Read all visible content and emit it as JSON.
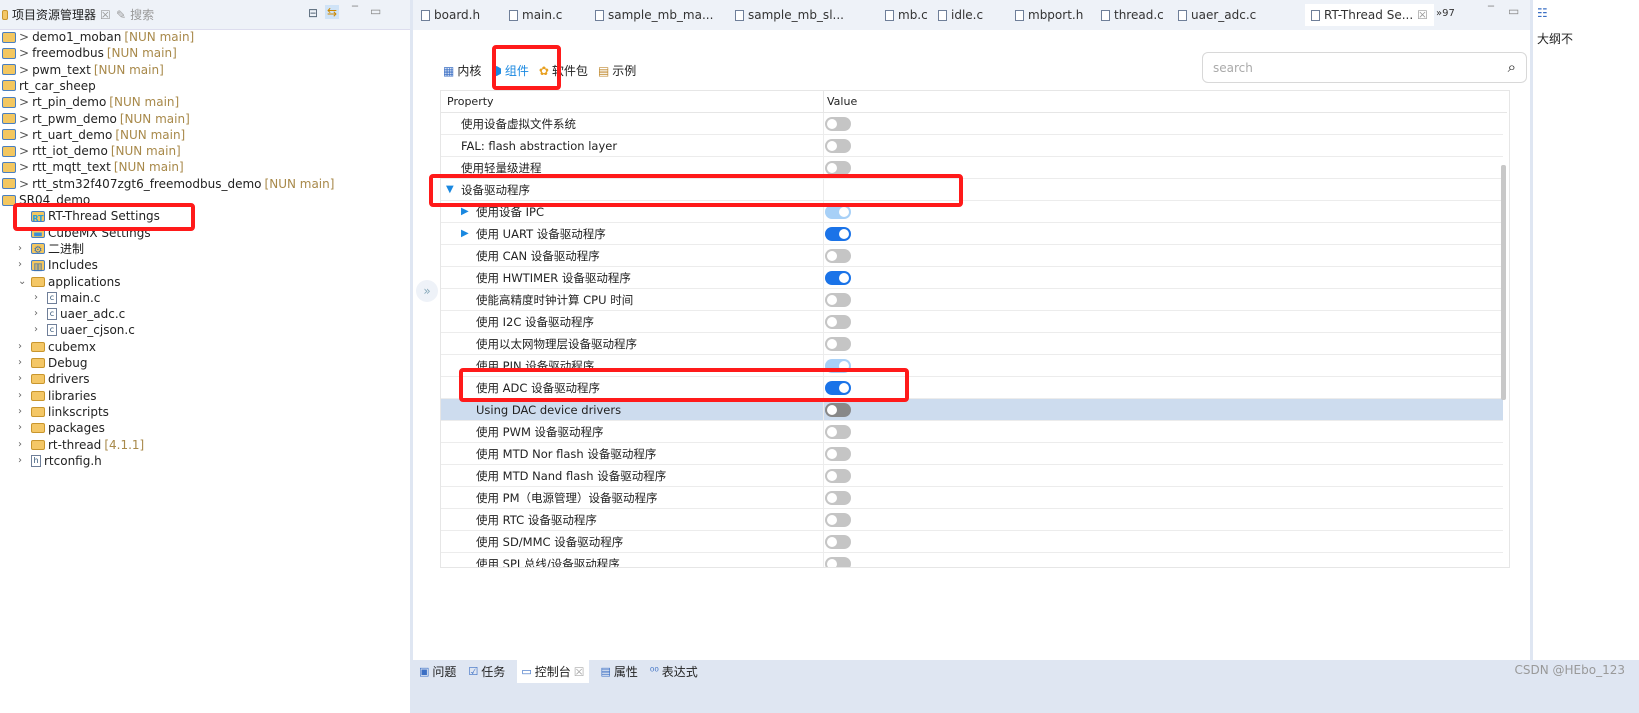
{
  "left_panel": {
    "tab_explorer": "项目资源管理器",
    "tab_search": "搜索",
    "tree": [
      {
        "label": "demo1_moban",
        "tag": "[NUN main]",
        "indent": 0,
        "icon": "project-warning-icon",
        "arrow": ">"
      },
      {
        "label": "freemodbus",
        "tag": "[NUN main]",
        "indent": 0,
        "icon": "project-warning-icon",
        "arrow": ">"
      },
      {
        "label": "pwm_text",
        "tag": "[NUN main]",
        "indent": 0,
        "icon": "project-icon",
        "arrow": ">"
      },
      {
        "label": "rt_car_sheep",
        "tag": "",
        "indent": 0,
        "icon": "project-icon",
        "arrow": ""
      },
      {
        "label": "rt_pin_demo",
        "tag": "[NUN main]",
        "indent": 0,
        "icon": "project-warning-icon",
        "arrow": ">"
      },
      {
        "label": "rt_pwm_demo",
        "tag": "[NUN main]",
        "indent": 0,
        "icon": "project-warning-icon",
        "arrow": ">"
      },
      {
        "label": "rt_uart_demo",
        "tag": "[NUN main]",
        "indent": 0,
        "icon": "project-icon",
        "arrow": ">"
      },
      {
        "label": "rtt_iot_demo",
        "tag": "[NUN main]",
        "indent": 0,
        "icon": "project-icon",
        "arrow": ">"
      },
      {
        "label": "rtt_mqtt_text",
        "tag": "[NUN main]",
        "indent": 0,
        "icon": "project-icon",
        "arrow": ">"
      },
      {
        "label": "rtt_stm32f407zgt6_freemodbus_demo",
        "tag": "[NUN main]",
        "indent": 0,
        "icon": "project-icon",
        "arrow": ">"
      },
      {
        "label": "SR04_demo",
        "tag": "",
        "indent": 0,
        "icon": "project-warning-icon",
        "arrow": ""
      },
      {
        "label": "RT-Thread Settings",
        "tag": "",
        "indent": 1,
        "icon": "rt-thread-icon",
        "arrow": ""
      },
      {
        "label": "CubeMX Settings",
        "tag": "",
        "indent": 1,
        "icon": "cubemx-icon",
        "arrow": ""
      },
      {
        "label": "二进制",
        "tag": "",
        "indent": 1,
        "icon": "binary-icon",
        "arrow": "›"
      },
      {
        "label": "Includes",
        "tag": "",
        "indent": 1,
        "icon": "includes-icon",
        "arrow": "›"
      },
      {
        "label": "applications",
        "tag": "",
        "indent": 1,
        "icon": "folder-icon",
        "arrow": "⌄"
      },
      {
        "label": "main.c",
        "tag": "",
        "indent": 2,
        "icon": "c-file-icon",
        "arrow": "›"
      },
      {
        "label": "uaer_adc.c",
        "tag": "",
        "indent": 2,
        "icon": "c-file-icon",
        "arrow": "›"
      },
      {
        "label": "uaer_cjson.c",
        "tag": "",
        "indent": 2,
        "icon": "c-file-icon",
        "arrow": "›"
      },
      {
        "label": "cubemx",
        "tag": "",
        "indent": 1,
        "icon": "folder-icon",
        "arrow": "›"
      },
      {
        "label": "Debug",
        "tag": "",
        "indent": 1,
        "icon": "folder-icon",
        "arrow": "›"
      },
      {
        "label": "drivers",
        "tag": "",
        "indent": 1,
        "icon": "folder-icon",
        "arrow": "›"
      },
      {
        "label": "libraries",
        "tag": "",
        "indent": 1,
        "icon": "folder-icon",
        "arrow": "›"
      },
      {
        "label": "linkscripts",
        "tag": "",
        "indent": 1,
        "icon": "folder-icon",
        "arrow": "›"
      },
      {
        "label": "packages",
        "tag": "",
        "indent": 1,
        "icon": "folder-icon",
        "arrow": "›"
      },
      {
        "label": "rt-thread",
        "tag": "[4.1.1]",
        "indent": 1,
        "icon": "folder-icon",
        "arrow": "›"
      },
      {
        "label": "rtconfig.h",
        "tag": "",
        "indent": 1,
        "icon": "h-file-icon",
        "arrow": "›"
      }
    ]
  },
  "editor_tabs": [
    "board.h",
    "main.c",
    "sample_mb_ma...",
    "sample_mb_sl...",
    "mb.c",
    "idle.c",
    "mbport.h",
    "thread.c",
    "uaer_adc.c",
    "RT-Thread Se..."
  ],
  "editor_tabs_overflow": "»97",
  "settings": {
    "tabs": [
      "内核",
      "组件",
      "软件包",
      "示例"
    ],
    "active_tab": "组件",
    "search_placeholder": "search",
    "columns": [
      "Property",
      "Value"
    ],
    "rows": [
      {
        "label": "使用设备虚拟文件系统",
        "level": 1,
        "value": "off"
      },
      {
        "label": "FAL: flash abstraction layer",
        "level": 1,
        "value": "off"
      },
      {
        "label": "使用轻量级进程",
        "level": 1,
        "value": "off"
      },
      {
        "label": "设备驱动程序",
        "level": 0,
        "expanded": true,
        "value": null
      },
      {
        "label": "使用设备 IPC",
        "level": 2,
        "expander": true,
        "value": "on-disabled"
      },
      {
        "label": "使用 UART 设备驱动程序",
        "level": 2,
        "expander": true,
        "value": "on"
      },
      {
        "label": "使用 CAN 设备驱动程序",
        "level": 2,
        "value": "off"
      },
      {
        "label": "使用 HWTIMER 设备驱动程序",
        "level": 2,
        "value": "on"
      },
      {
        "label": "使能高精度时钟计算 CPU 时间",
        "level": 2,
        "value": "off"
      },
      {
        "label": "使用 I2C 设备驱动程序",
        "level": 2,
        "value": "off"
      },
      {
        "label": "使用以太网物理层设备驱动程序",
        "level": 2,
        "value": "off"
      },
      {
        "label": "使用 PIN 设备驱动程序",
        "level": 2,
        "value": "on-disabled"
      },
      {
        "label": "使用 ADC 设备驱动程序",
        "level": 2,
        "value": "on"
      },
      {
        "label": "Using DAC device drivers",
        "level": 2,
        "value": "off",
        "selected": true
      },
      {
        "label": "使用 PWM 设备驱动程序",
        "level": 2,
        "value": "off"
      },
      {
        "label": "使用 MTD Nor flash 设备驱动程序",
        "level": 2,
        "value": "off"
      },
      {
        "label": "使用 MTD Nand flash 设备驱动程序",
        "level": 2,
        "value": "off"
      },
      {
        "label": "使用 PM（电源管理）设备驱动程序",
        "level": 2,
        "value": "off"
      },
      {
        "label": "使用 RTC 设备驱动程序",
        "level": 2,
        "value": "off"
      },
      {
        "label": "使用 SD/MMC 设备驱动程序",
        "level": 2,
        "value": "off"
      },
      {
        "label": "使用 SPI 总线/设备驱动程序",
        "level": 2,
        "value": "off"
      }
    ]
  },
  "right_panel": {
    "title": "大纲不"
  },
  "bottom_tabs": [
    "问题",
    "任务",
    "控制台",
    "属性",
    "表达式"
  ],
  "watermark": "CSDN @HEbo_123",
  "colors": {
    "toggle_on": "#1a73e8",
    "highlight": "#ff1a1a",
    "selected_row": "#cddcee"
  }
}
